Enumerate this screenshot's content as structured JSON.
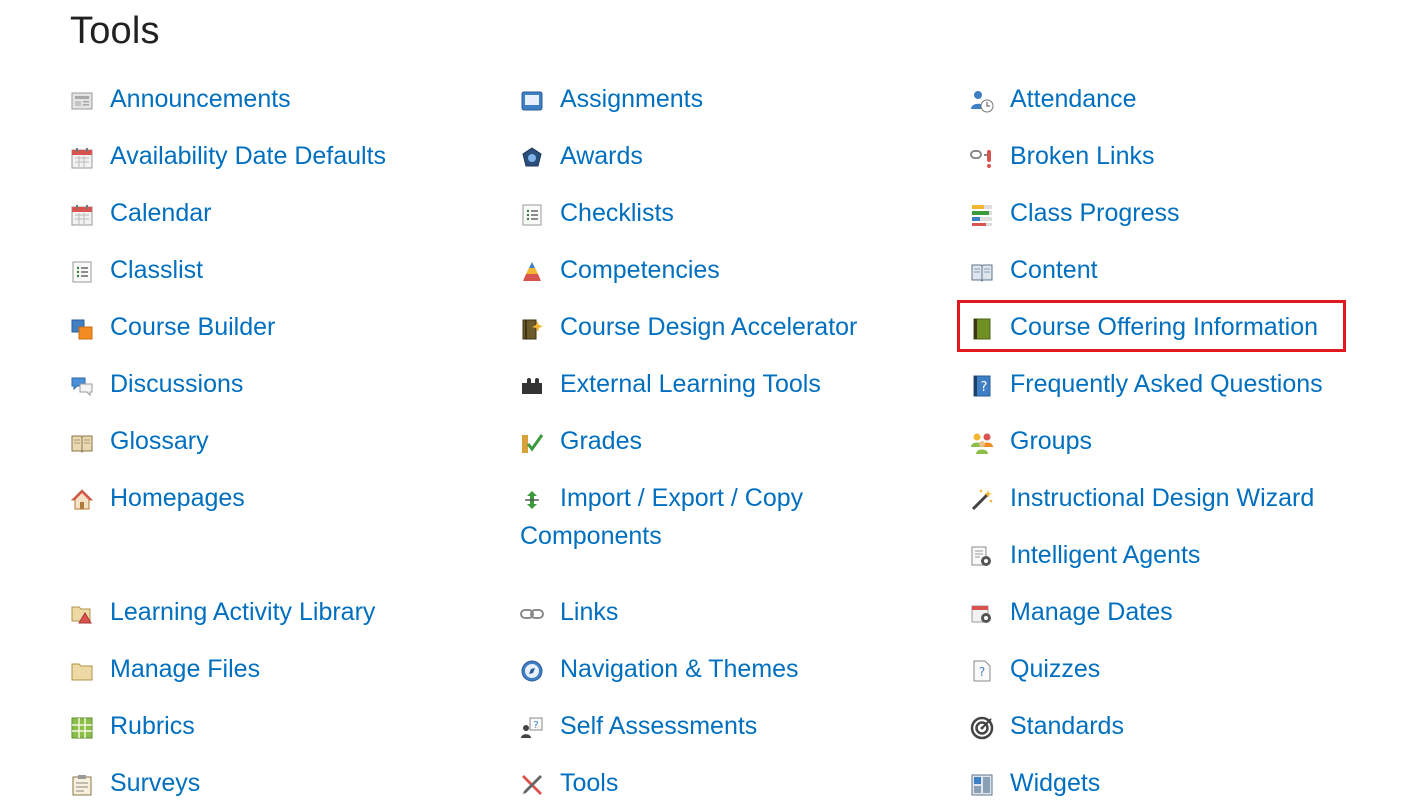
{
  "page": {
    "title": "Tools"
  },
  "columns": [
    [
      {
        "label": "Announcements",
        "icon": "announcements-icon"
      },
      {
        "label": "Availability Date Defaults",
        "icon": "calendar-icon"
      },
      {
        "label": "Calendar",
        "icon": "calendar-icon"
      },
      {
        "label": "Classlist",
        "icon": "list-icon"
      },
      {
        "label": "Course Builder",
        "icon": "course-builder-icon"
      },
      {
        "label": "Discussions",
        "icon": "speech-bubbles-icon"
      },
      {
        "label": "Glossary",
        "icon": "open-book-icon"
      },
      {
        "label": "Homepages",
        "icon": "house-icon"
      },
      {
        "label": "Learning Activity Library",
        "icon": "folder-triangle-icon"
      },
      {
        "label": "Manage Files",
        "icon": "folder-icon"
      },
      {
        "label": "Rubrics",
        "icon": "grid-icon"
      },
      {
        "label": "Surveys",
        "icon": "clipboard-icon"
      }
    ],
    [
      {
        "label": "Assignments",
        "icon": "monitor-icon"
      },
      {
        "label": "Awards",
        "icon": "award-badge-icon"
      },
      {
        "label": "Checklists",
        "icon": "checklist-icon"
      },
      {
        "label": "Competencies",
        "icon": "pyramid-icon"
      },
      {
        "label": "Course Design Accelerator",
        "icon": "book-spark-icon"
      },
      {
        "label": "External Learning Tools",
        "icon": "puzzle-piece-icon"
      },
      {
        "label": "Grades",
        "icon": "checkmark-grade-icon"
      },
      {
        "label": "Import / Export / Copy Components",
        "icon": "arrows-icon"
      },
      {
        "label": "Links",
        "icon": "chain-link-icon"
      },
      {
        "label": "Navigation & Themes",
        "icon": "compass-icon"
      },
      {
        "label": "Self Assessments",
        "icon": "person-question-icon"
      },
      {
        "label": "Tools",
        "icon": "wrench-screwdriver-icon"
      }
    ],
    [
      {
        "label": "Attendance",
        "icon": "person-clock-icon"
      },
      {
        "label": "Broken Links",
        "icon": "broken-link-icon"
      },
      {
        "label": "Class Progress",
        "icon": "progress-bars-icon"
      },
      {
        "label": "Content",
        "icon": "open-book-icon"
      },
      {
        "label": "Course Offering Information",
        "icon": "green-book-icon"
      },
      {
        "label": "Frequently Asked Questions",
        "icon": "question-book-icon"
      },
      {
        "label": "Groups",
        "icon": "people-group-icon"
      },
      {
        "label": "Instructional Design Wizard",
        "icon": "magic-wand-icon"
      },
      {
        "label": "Intelligent Agents",
        "icon": "document-gear-icon"
      },
      {
        "label": "Manage Dates",
        "icon": "calendar-gear-icon"
      },
      {
        "label": "Quizzes",
        "icon": "quiz-page-icon"
      },
      {
        "label": "Standards",
        "icon": "target-icon"
      },
      {
        "label": "Widgets",
        "icon": "widgets-grid-icon"
      }
    ]
  ],
  "highlighted": "Course Offering Information",
  "colors": {
    "link": "#006fbf",
    "highlight_border": "#e0191f",
    "title": "#202122"
  }
}
